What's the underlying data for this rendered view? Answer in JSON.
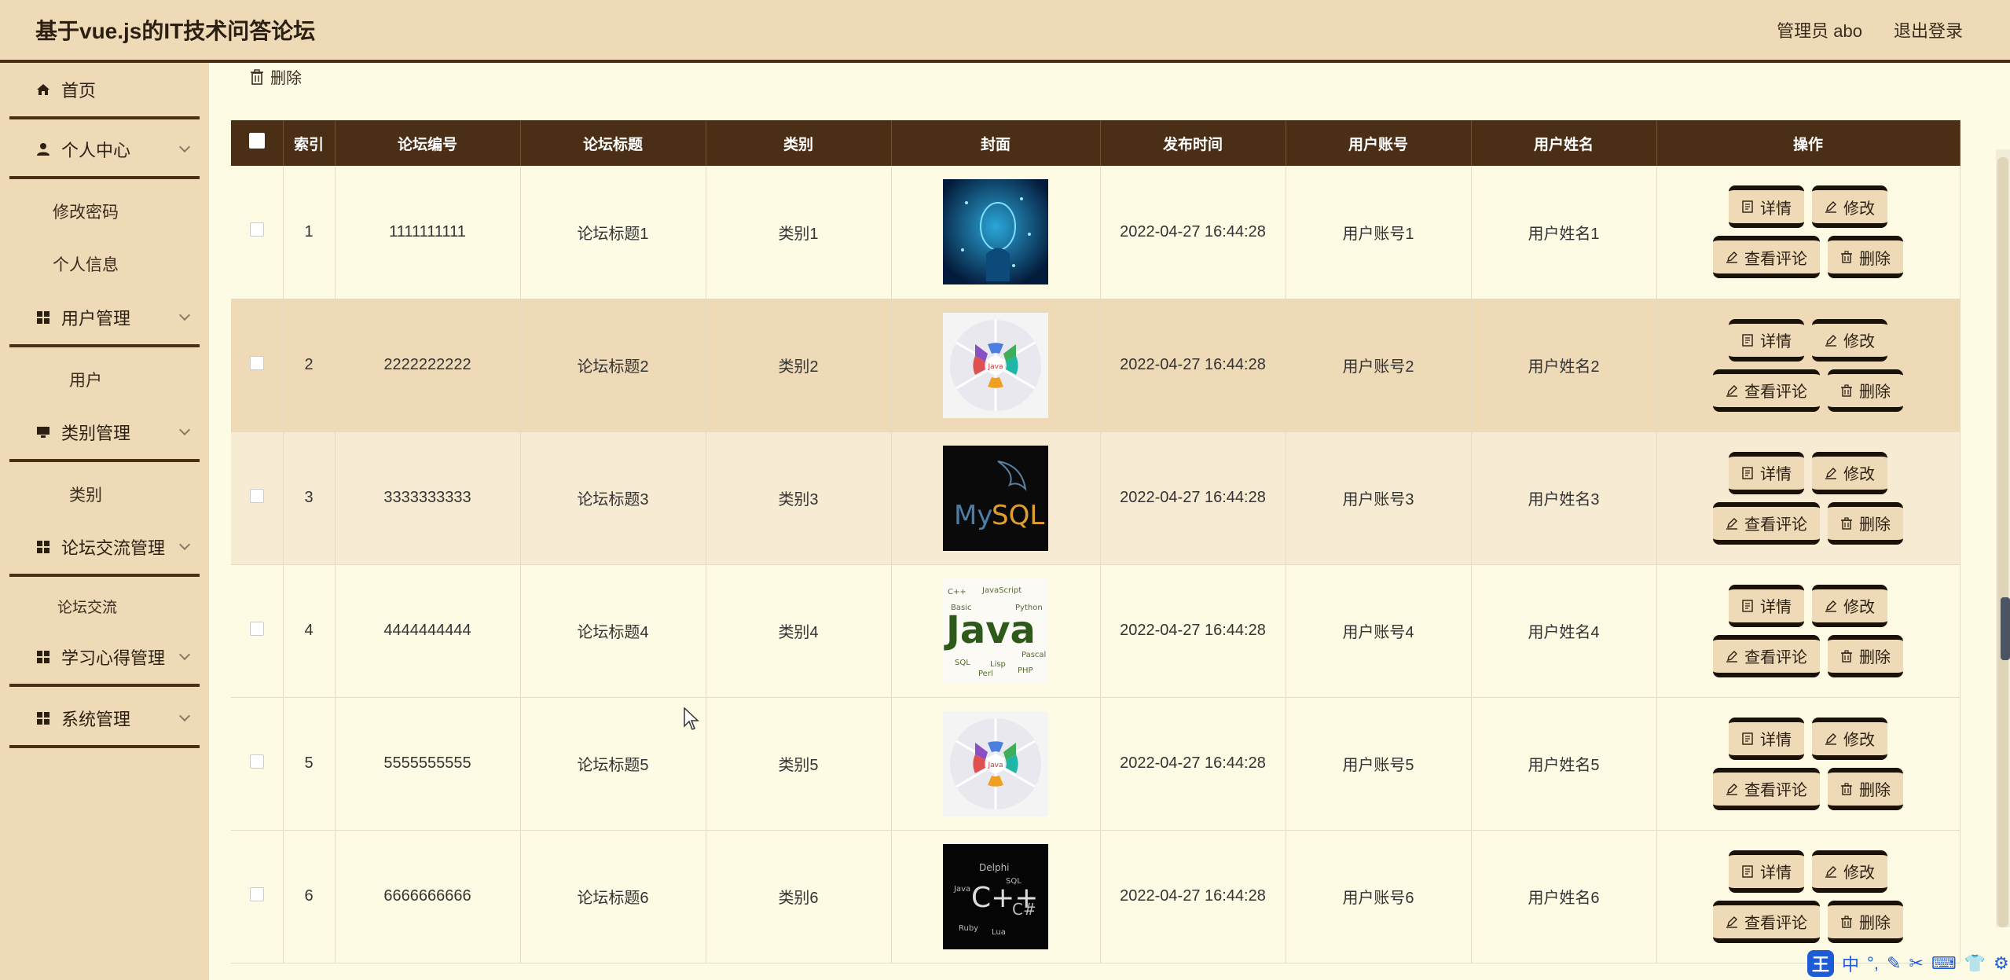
{
  "header": {
    "title": "基于vue.js的IT技术问答论坛",
    "admin_label": "管理员 abo",
    "logout_label": "退出登录"
  },
  "sidebar": {
    "items": [
      {
        "label": "首页",
        "icon": "home-icon"
      },
      {
        "label": "个人中心",
        "icon": "user-icon"
      },
      {
        "label": "用户管理",
        "icon": "grid-icon"
      },
      {
        "label": "类别管理",
        "icon": "monitor-icon"
      },
      {
        "label": "论坛交流管理",
        "icon": "grid-icon"
      },
      {
        "label": "学习心得管理",
        "icon": "grid-icon"
      },
      {
        "label": "系统管理",
        "icon": "grid-icon"
      }
    ],
    "subitems": {
      "change_password": "修改密码",
      "personal_info": "个人信息",
      "user": "用户",
      "category": "类别",
      "forum": "论坛交流"
    }
  },
  "toolbar": {
    "delete_label": "删除"
  },
  "table": {
    "headers": [
      "索引",
      "论坛编号",
      "论坛标题",
      "类别",
      "封面",
      "发布时间",
      "用户账号",
      "用户姓名",
      "操作"
    ],
    "rows": [
      {
        "index": "1",
        "forum_no": "1111111111",
        "title": "论坛标题1",
        "category": "类别1",
        "cover": "ai-head",
        "time": "2022-04-27 16:44:28",
        "account": "用户账号1",
        "name": "用户姓名1"
      },
      {
        "index": "2",
        "forum_no": "2222222222",
        "title": "论坛标题2",
        "category": "类别2",
        "cover": "java-wheel",
        "time": "2022-04-27 16:44:28",
        "account": "用户账号2",
        "name": "用户姓名2"
      },
      {
        "index": "3",
        "forum_no": "3333333333",
        "title": "论坛标题3",
        "category": "类别3",
        "cover": "mysql",
        "time": "2022-04-27 16:44:28",
        "account": "用户账号3",
        "name": "用户姓名3"
      },
      {
        "index": "4",
        "forum_no": "4444444444",
        "title": "论坛标题4",
        "category": "类别4",
        "cover": "java-cloud",
        "time": "2022-04-27 16:44:28",
        "account": "用户账号4",
        "name": "用户姓名4"
      },
      {
        "index": "5",
        "forum_no": "5555555555",
        "title": "论坛标题5",
        "category": "类别5",
        "cover": "java-wheel",
        "time": "2022-04-27 16:44:28",
        "account": "用户账号5",
        "name": "用户姓名5"
      },
      {
        "index": "6",
        "forum_no": "6666666666",
        "title": "论坛标题6",
        "category": "类别6",
        "cover": "cpp-cloud",
        "time": "2022-04-27 16:44:28",
        "account": "用户账号6",
        "name": "用户姓名6"
      }
    ],
    "actions": {
      "detail": "详情",
      "edit": "修改",
      "view_comments": "查看评论",
      "delete": "删除"
    }
  },
  "ime": {
    "logo": "王",
    "mode": "中"
  },
  "colors": {
    "header_bg": "#efdab8",
    "accent_dark": "#4a2f16",
    "page_bg": "#fefbe4"
  }
}
